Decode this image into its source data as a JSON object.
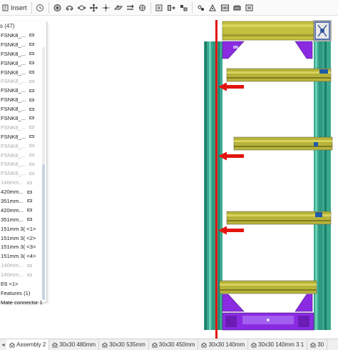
{
  "toolbar": {
    "insert_label": "Insert",
    "icons": [
      "insert-icon",
      "history-icon",
      "mate-fastened-icon",
      "mate-revolute-icon",
      "mate-slider-icon",
      "mate-cylindrical-icon",
      "mate-pin-slot-icon",
      "mate-planar-icon",
      "mate-parallel-icon",
      "mate-ball-icon",
      "replicate-icon",
      "linear-pattern-icon",
      "circular-pattern-icon",
      "mate-connector-icon",
      "group-icon",
      "relations-icon",
      "explode-icon",
      "named-positions-icon"
    ]
  },
  "panel": {
    "header": "s (47)",
    "items": [
      {
        "label": "FSNK8_...",
        "dim": false
      },
      {
        "label": "FSNK8_...",
        "dim": false
      },
      {
        "label": "FSNK8_...",
        "dim": false
      },
      {
        "label": "FSNK8_...",
        "dim": false
      },
      {
        "label": "FSNK8_...",
        "dim": false
      },
      {
        "label": "FSNK8_...",
        "dim": true
      },
      {
        "label": "FSNK8_...",
        "dim": false
      },
      {
        "label": "FSNK8_...",
        "dim": false
      },
      {
        "label": "FSNK8_...",
        "dim": false
      },
      {
        "label": "FSNK8_...",
        "dim": false
      },
      {
        "label": "FSNK8_...",
        "dim": true
      },
      {
        "label": "FSNK8_...",
        "dim": false
      },
      {
        "label": "FSNK8_...",
        "dim": true
      },
      {
        "label": "FSNK8_...",
        "dim": true
      },
      {
        "label": "FSNK8_...",
        "dim": true
      },
      {
        "label": "FSNK8_...",
        "dim": true
      },
      {
        "label": "140mm...",
        "dim": true
      },
      {
        "label": "420mm...",
        "dim": false
      },
      {
        "label": "351mm...",
        "dim": false
      },
      {
        "label": "420mm...",
        "dim": false
      },
      {
        "label": "351mm...",
        "dim": false
      },
      {
        "label": "151mm 3( <1>",
        "dim": false
      },
      {
        "label": "151mm 3( <2>",
        "dim": false
      },
      {
        "label": "151mm 3( <3>",
        "dim": false
      },
      {
        "label": "151mm 3( <4>",
        "dim": false
      },
      {
        "label": "140mm...",
        "dim": true
      },
      {
        "label": "140mm...",
        "dim": true
      },
      {
        "label": "E6 <1>",
        "dim": false
      },
      {
        "label": "Features (1)",
        "dim": false
      },
      {
        "label": "Mate connector 1",
        "dim": false
      }
    ]
  },
  "tabs": [
    {
      "label": "Assembly 2",
      "active": true
    },
    {
      "label": "30x30 480mm",
      "active": false
    },
    {
      "label": "30x30 535mm",
      "active": false
    },
    {
      "label": "30x30 450mm",
      "active": false
    },
    {
      "label": "30x30 140mm",
      "active": false
    },
    {
      "label": "30x30 140mm 3 1",
      "active": false
    },
    {
      "label": "30",
      "active": false
    }
  ],
  "colors": {
    "extrusion_teal": "#3aa98f",
    "extrusion_yellow": "#b7b33a",
    "bracket_purple": "#8a2be2",
    "annotation_red": "#e3140f",
    "selection_blue": "#1e5aa8"
  }
}
